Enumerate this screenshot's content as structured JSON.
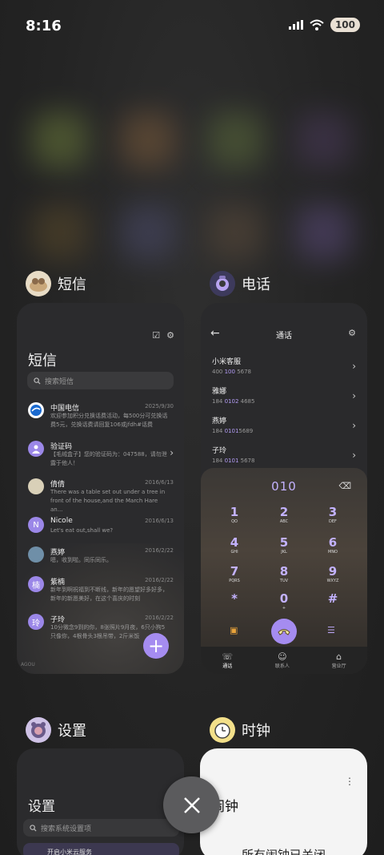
{
  "status": {
    "time": "8:16",
    "battery": "100"
  },
  "apps": {
    "sms": {
      "name": "短信",
      "screen_title": "短信",
      "search_placeholder": "搜索短信",
      "watermark": "AGOU",
      "messages": [
        {
          "name": "中国电信",
          "date": "2025/9/30",
          "preview": "欢迎参加积分兑换话费活动，每500分可兑换话费5元，兑换话费请回复106或jfdh#话费"
        },
        {
          "name": "验证码",
          "date": "",
          "preview": "【毛绒盒子】您的验证码为：047588，请勿泄露于他人！"
        },
        {
          "name": "倩倩",
          "date": "2016/6/13",
          "preview": "There was a table set out under a tree in front of the house,and the March Hare an..."
        },
        {
          "name": "Nicole",
          "date": "2016/6/13",
          "preview": "Let's eat out,shall we?"
        },
        {
          "name": "燕婷",
          "date": "2016/2/22",
          "preview": "嗯，收到啦。同乐同乐。"
        },
        {
          "name": "紫楠",
          "date": "2016/2/22",
          "preview": "新年到啊祝福到不断线，新年的愿望好多好多，新年的新愿美好，在这个喜庆的时刻"
        },
        {
          "name": "子玲",
          "date": "2016/2/22",
          "preview": "10分微念9到的你，8张照片9月夜，6只小狗5只像你，4根骨头3根吊带，2斤米饭"
        }
      ],
      "avatars": {
        "nicole": "N",
        "zinan": "楠",
        "ziling": "玲"
      },
      "fab": "+"
    },
    "phone": {
      "name": "电话",
      "screen_title": "通话",
      "contacts": [
        {
          "name": "小米客服",
          "pre": "400 ",
          "hl": "100",
          "post": " 5678"
        },
        {
          "name": "雅娜",
          "pre": "184 ",
          "hl": "0102",
          "post": " 4685"
        },
        {
          "name": "燕婷",
          "pre": "184 ",
          "hl": "0101",
          "post": "5689"
        },
        {
          "name": "子玲",
          "pre": "184 ",
          "hl": "0101",
          "post": " 5678"
        }
      ],
      "dial_number": "010",
      "keys": [
        {
          "d": "1",
          "l": "QO"
        },
        {
          "d": "2",
          "l": "ABC"
        },
        {
          "d": "3",
          "l": "DEF"
        },
        {
          "d": "4",
          "l": "GHI"
        },
        {
          "d": "5",
          "l": "JKL"
        },
        {
          "d": "6",
          "l": "MNO"
        },
        {
          "d": "7",
          "l": "PQRS"
        },
        {
          "d": "8",
          "l": "TUV"
        },
        {
          "d": "9",
          "l": "WXYZ"
        },
        {
          "d": "*",
          "l": ""
        },
        {
          "d": "0",
          "l": "+"
        },
        {
          "d": "#",
          "l": ""
        }
      ],
      "tabs": [
        {
          "icon": "phone-icon",
          "label": "通话"
        },
        {
          "icon": "contacts-icon",
          "label": "联系人"
        },
        {
          "icon": "store-icon",
          "label": "营业厅"
        }
      ]
    },
    "settings": {
      "name": "设置",
      "screen_title": "设置",
      "search_placeholder": "搜索系统设置项",
      "row_label": "开启小米云服务"
    },
    "clock": {
      "name": "时钟",
      "screen_title": "闹钟",
      "status": "所有闹钟已关闭"
    }
  },
  "colors": {
    "accent": "#a58cf0",
    "accent_text": "#c3b2ff",
    "background": "#232323"
  }
}
